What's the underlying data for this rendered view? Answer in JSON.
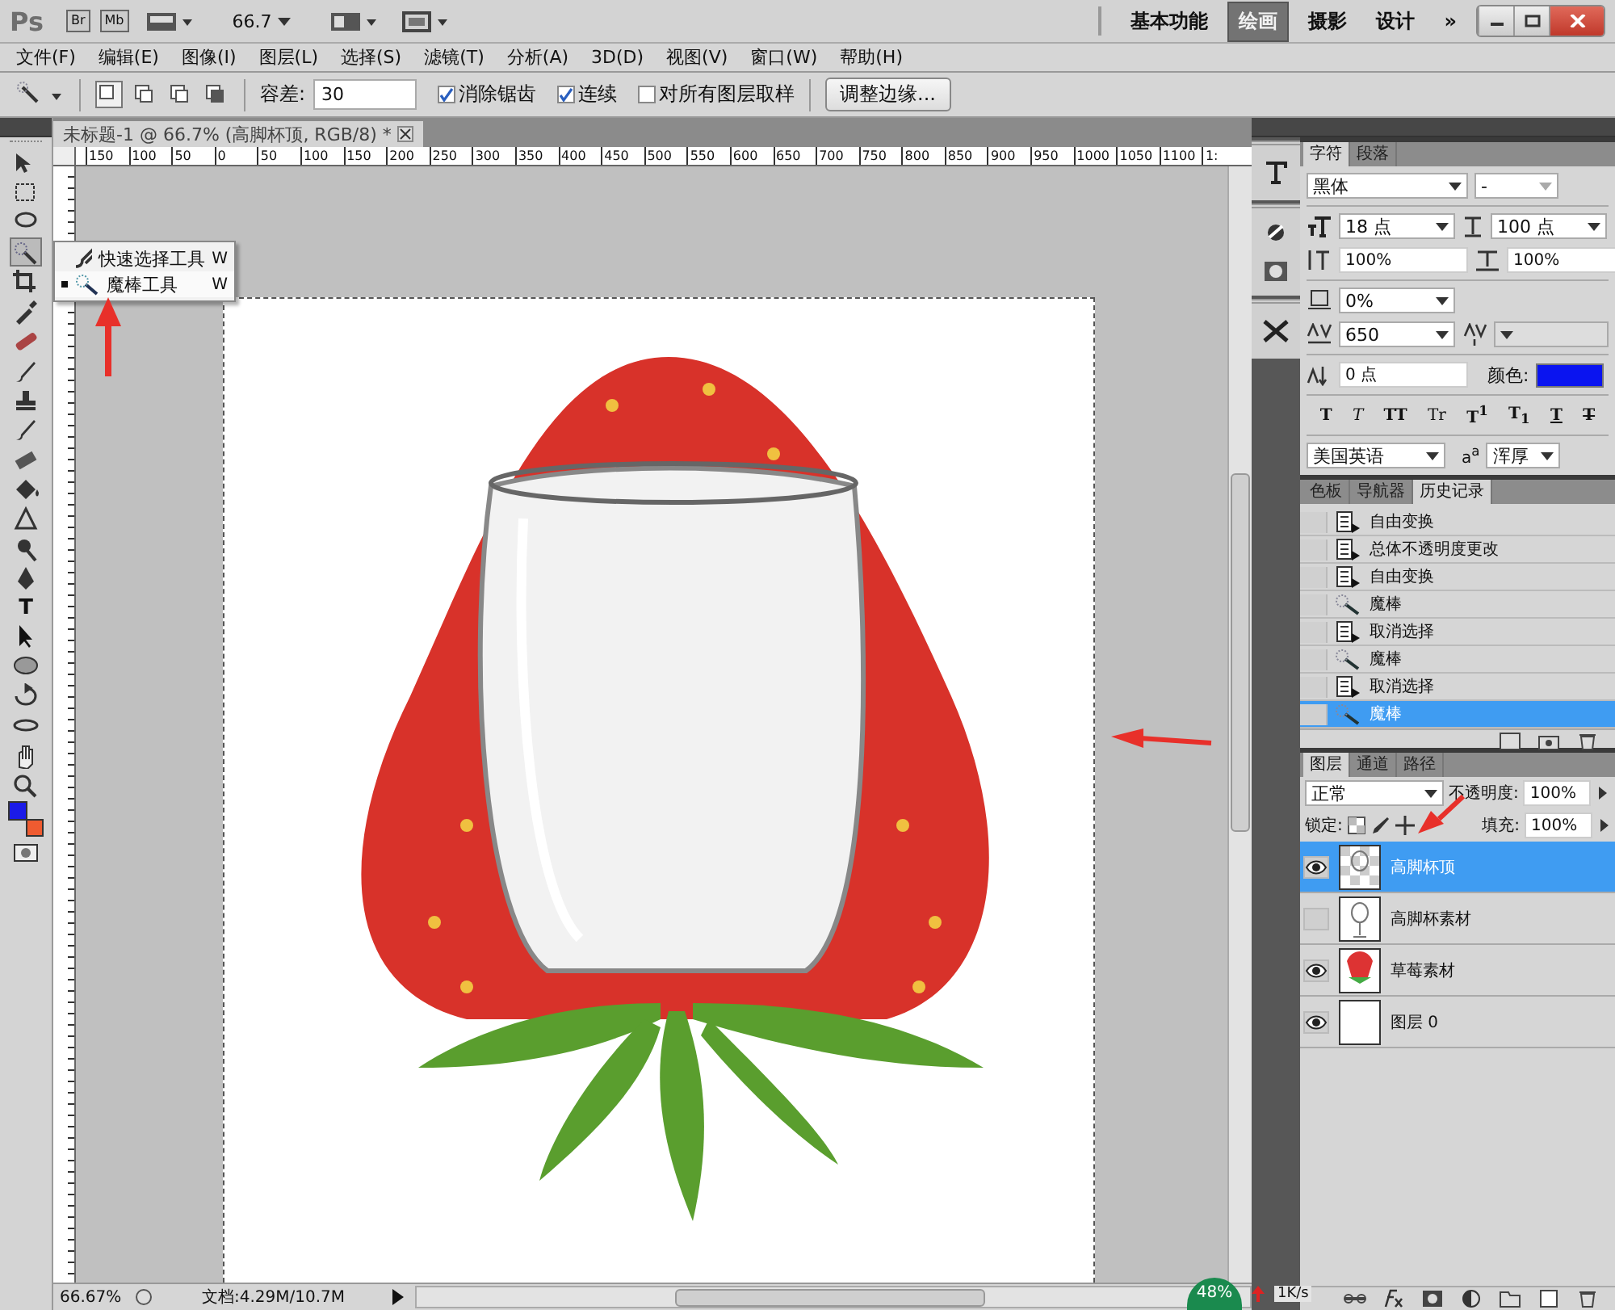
{
  "app_bar": {
    "logo": "Ps",
    "bridge_buttons": [
      "Br",
      "Mb"
    ],
    "zoom": "66.7",
    "workspaces": [
      {
        "label": "基本功能",
        "selected": false
      },
      {
        "label": "绘画",
        "selected": true
      },
      {
        "label": "摄影",
        "selected": false
      },
      {
        "label": "设计",
        "selected": false
      }
    ],
    "more": "»"
  },
  "menu": [
    "文件(F)",
    "编辑(E)",
    "图像(I)",
    "图层(L)",
    "选择(S)",
    "滤镜(T)",
    "分析(A)",
    "3D(D)",
    "视图(V)",
    "窗口(W)",
    "帮助(H)"
  ],
  "options_bar": {
    "selection_modes": [
      {
        "selected": true
      },
      {
        "selected": false
      },
      {
        "selected": false
      },
      {
        "selected": false
      }
    ],
    "tolerance_label": "容差:",
    "tolerance": "30",
    "checkboxes": [
      {
        "label": "消除锯齿",
        "checked": true
      },
      {
        "label": "连续",
        "checked": true
      },
      {
        "label": "对所有图层取样",
        "checked": false
      }
    ],
    "refine_button": "调整边缘..."
  },
  "toolbar": {
    "type_tool": "T"
  },
  "tool_flyout": [
    {
      "label": "快速选择工具",
      "shortcut": "W",
      "selected": false
    },
    {
      "label": "魔棒工具",
      "shortcut": "W",
      "selected": true
    }
  ],
  "document": {
    "tab_title": "未标题-1 @ 66.7% (高脚杯顶, RGB/8) *",
    "ruler_labels": [
      "150",
      "100",
      "50",
      "0",
      "50",
      "100",
      "150",
      "200",
      "250",
      "300",
      "350",
      "400",
      "450",
      "500",
      "550",
      "600",
      "650",
      "700",
      "750",
      "800",
      "850",
      "900",
      "950",
      "1000",
      "1050",
      "1100",
      "1:"
    ]
  },
  "character_panel": {
    "tabs": [
      {
        "label": "字符",
        "selected": true
      },
      {
        "label": "段落",
        "selected": false
      }
    ],
    "font": "黑体",
    "font_style": "-",
    "size": "18 点",
    "leading": "100 点",
    "vertical_scale": "100%",
    "horizontal_scale": "100%",
    "tsume": "0%",
    "tracking": "650",
    "baseline": "0 点",
    "color_label": "颜色:",
    "color": "#0a14f0",
    "style_buttons": [
      {
        "kind": "bold",
        "label": "T"
      },
      {
        "kind": "italic",
        "label": "T"
      },
      {
        "kind": "caps",
        "label": "TT"
      },
      {
        "kind": "smallcaps",
        "label": "Tr"
      },
      {
        "kind": "super",
        "label": "T$^{1}$"
      },
      {
        "kind": "sub",
        "label": "T$_{1}$"
      },
      {
        "kind": "underline",
        "label": "T"
      },
      {
        "kind": "strike",
        "label": "T"
      }
    ],
    "language": "美国英语",
    "aa_glyph": "a$^{a}$",
    "antialias": "浑厚"
  },
  "history_panel": {
    "tabs": [
      {
        "label": "色板",
        "selected": false
      },
      {
        "label": "导航器",
        "selected": false
      },
      {
        "label": "历史记录",
        "selected": true
      }
    ],
    "items": [
      {
        "label": "自由变换",
        "kind": "doc",
        "selected": false
      },
      {
        "label": "总体不透明度更改",
        "kind": "doc",
        "selected": false
      },
      {
        "label": "自由变换",
        "kind": "doc",
        "selected": false
      },
      {
        "label": "魔棒",
        "kind": "wand",
        "selected": false
      },
      {
        "label": "取消选择",
        "kind": "doc",
        "selected": false
      },
      {
        "label": "魔棒",
        "kind": "wand",
        "selected": false
      },
      {
        "label": "取消选择",
        "kind": "doc",
        "selected": false
      },
      {
        "label": "魔棒",
        "kind": "wand",
        "selected": true
      }
    ]
  },
  "layers_panel": {
    "tabs": [
      {
        "label": "图层",
        "selected": true
      },
      {
        "label": "通道",
        "selected": false
      },
      {
        "label": "路径",
        "selected": false
      }
    ],
    "blend_mode": "正常",
    "opacity_label": "不透明度:",
    "opacity": "100%",
    "lock_label": "锁定:",
    "fill_label": "填充:",
    "fill": "100%",
    "layers": [
      {
        "name": "高脚杯顶",
        "kind": "glass_transparent",
        "visible": true,
        "selected": true
      },
      {
        "name": "高脚杯素材",
        "kind": "glass",
        "visible": false,
        "selected": false
      },
      {
        "name": "草莓素材",
        "kind": "strawberry",
        "visible": true,
        "selected": false
      },
      {
        "name": "图层 0",
        "kind": "white",
        "visible": true,
        "selected": false
      }
    ]
  },
  "status_bar": {
    "zoom": "66.67%",
    "doc_info": "文档:4.29M/10.7M"
  },
  "tray_overlay": {
    "percent": "48%",
    "speed": "1K/s"
  }
}
